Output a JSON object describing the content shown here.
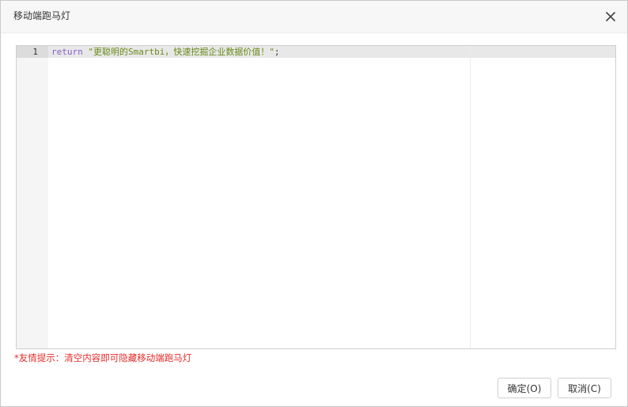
{
  "dialog": {
    "title": "移动端跑马灯",
    "close_icon": "close-icon"
  },
  "editor": {
    "lines": [
      {
        "number": "1",
        "keyword": "return",
        "string": "\"更聪明的Smartbi，快速挖掘企业数据价值！\"",
        "terminator": ";"
      }
    ]
  },
  "tip": "*友情提示：清空内容即可隐藏移动端跑马灯",
  "buttons": {
    "ok_label": "确定(O)",
    "cancel_label": "取消(C)"
  },
  "colors": {
    "keyword": "#8a5cc9",
    "string": "#6b8a1a",
    "tip": "#e62b2b",
    "header_bg": "#f7f7f7",
    "gutter_bg": "#f5f5f5"
  }
}
